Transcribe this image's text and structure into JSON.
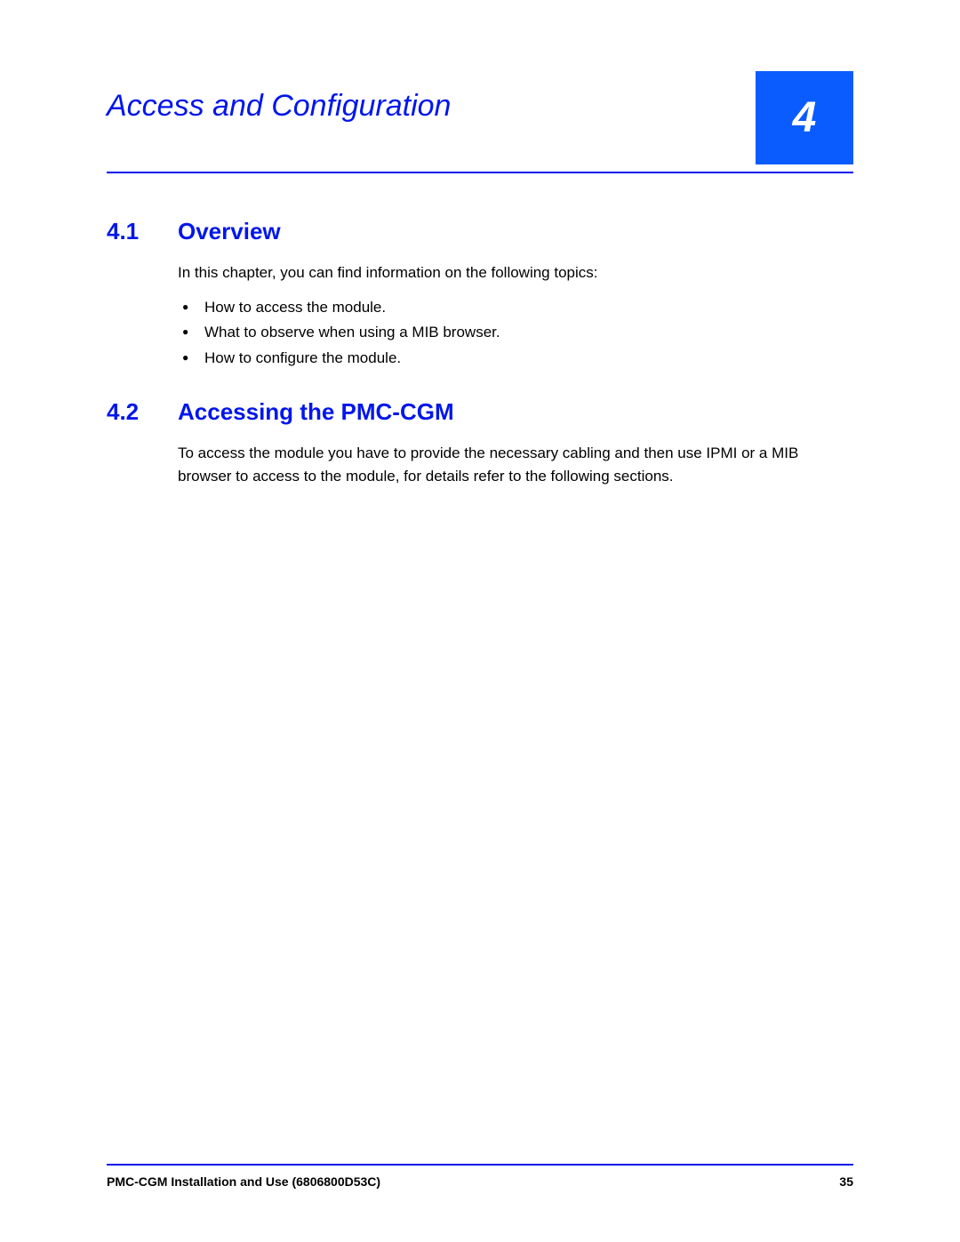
{
  "chapter": {
    "title": "Access and Configuration",
    "number": "4"
  },
  "sections": [
    {
      "number": "4.1",
      "name": "Overview",
      "intro": "In this chapter, you can find information on the following topics:",
      "bullets": [
        "How to access the module.",
        "What to observe when using a MIB browser.",
        "How to configure the module."
      ]
    },
    {
      "number": "4.2",
      "name": "Accessing the PMC-CGM",
      "body": "To access the module you have to provide the necessary cabling and then use IPMI or a MIB browser to access to the module, for details refer to the following sections."
    }
  ],
  "footer": {
    "left": "PMC-CGM Installation and Use (6806800D53C)",
    "right": "35"
  }
}
